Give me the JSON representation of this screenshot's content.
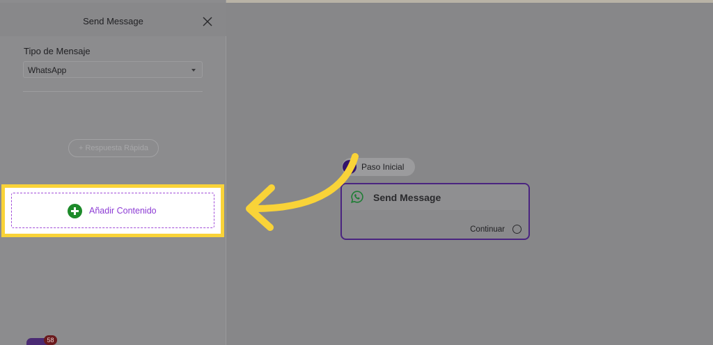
{
  "panel": {
    "title": "Send Message",
    "message_type_label": "Tipo de Mensaje",
    "message_type_value": "WhatsApp",
    "quick_reply_label": "+ Respuesta Rápida",
    "add_content_label": "Añadir Contenido",
    "badge_count": "58",
    "icons": {
      "close": "close-icon",
      "dropdown": "chevron-down-icon",
      "add": "plus-circle-icon"
    }
  },
  "canvas": {
    "start_label": "Paso Inicial",
    "node_title": "Send Message",
    "node_output_label": "Continuar",
    "icons": {
      "node": "whatsapp-icon"
    }
  },
  "colors": {
    "highlight": "#f9d338",
    "accent_purple": "#8c3bd4",
    "add_green": "#1d8a2a"
  }
}
